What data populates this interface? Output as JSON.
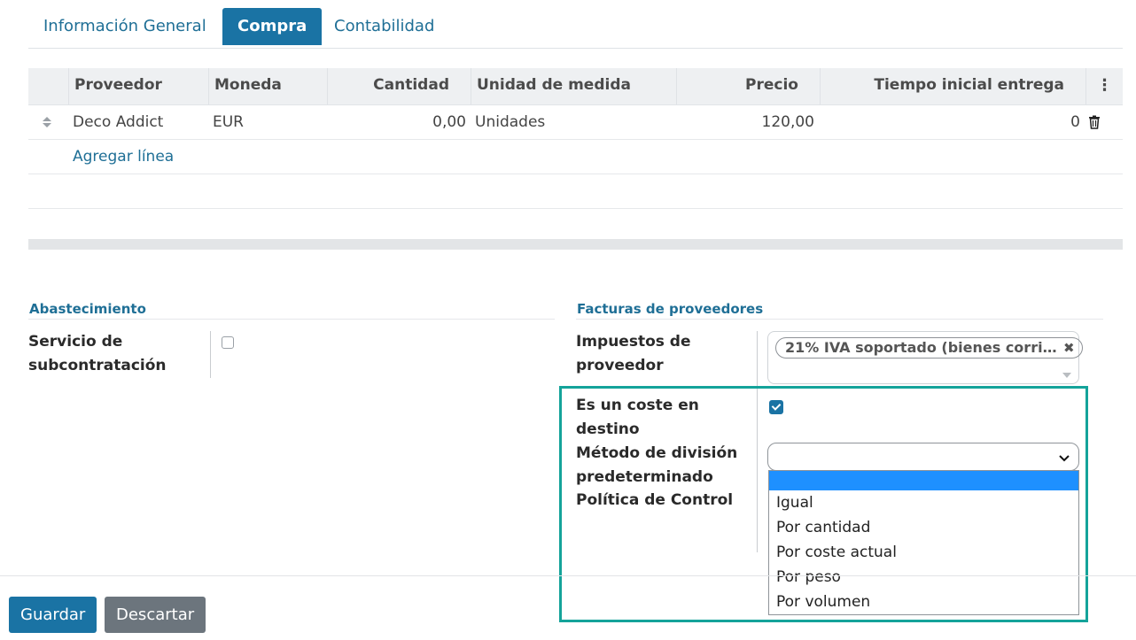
{
  "tabs": [
    "Información General",
    "Compra",
    "Contabilidad"
  ],
  "vendor_table": {
    "headers": {
      "vendor": "Proveedor",
      "currency": "Moneda",
      "quantity": "Cantidad",
      "uom": "Unidad de medida",
      "price": "Precio",
      "lead_time": "Tiempo inicial entrega"
    },
    "rows": [
      {
        "vendor": "Deco Addict",
        "currency": "EUR",
        "quantity": "0,00",
        "uom": "Unidades",
        "price": "120,00",
        "lead_time": "0"
      }
    ],
    "add_line": "Agregar línea"
  },
  "supply": {
    "title": "Abastecimiento",
    "subcontract_label": "Servicio de subcontratación",
    "subcontract_checked": false
  },
  "vendor_bills": {
    "title": "Facturas de proveedores",
    "taxes_label": "Impuestos de proveedor",
    "taxes_tag": "21% IVA soportado (bienes corri…",
    "landed_cost_label": "Es un coste en destino",
    "landed_cost_checked": true,
    "split_method_label": "Método de división predeterminado",
    "control_policy_label": "Política de Control",
    "split_options": [
      "",
      "Igual",
      "Por cantidad",
      "Por coste actual",
      "Por peso",
      "Por volumen"
    ]
  },
  "footer": {
    "save": "Guardar",
    "discard": "Descartar"
  },
  "colors": {
    "primary": "#1a73a4",
    "highlight": "#14a39a",
    "selected_option": "#1e90ff"
  }
}
